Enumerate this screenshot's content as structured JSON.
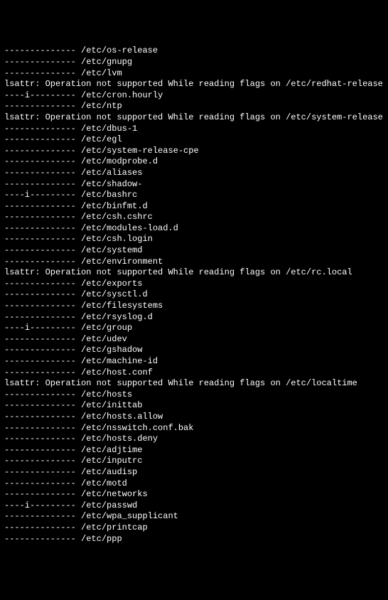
{
  "attr_normal": "--------------",
  "attr_immutable": "----i---------",
  "lines": [
    {
      "type": "entry",
      "attrs": "normal",
      "path": "/etc/os-release"
    },
    {
      "type": "entry",
      "attrs": "normal",
      "path": "/etc/gnupg"
    },
    {
      "type": "entry",
      "attrs": "normal",
      "path": "/etc/lvm"
    },
    {
      "type": "error",
      "text": "lsattr: Operation not supported While reading flags on /etc/redhat-release"
    },
    {
      "type": "entry",
      "attrs": "immutable",
      "path": "/etc/cron.hourly"
    },
    {
      "type": "entry",
      "attrs": "normal",
      "path": "/etc/ntp"
    },
    {
      "type": "error",
      "text": "lsattr: Operation not supported While reading flags on /etc/system-release"
    },
    {
      "type": "entry",
      "attrs": "normal",
      "path": "/etc/dbus-1"
    },
    {
      "type": "entry",
      "attrs": "normal",
      "path": "/etc/egl"
    },
    {
      "type": "entry",
      "attrs": "normal",
      "path": "/etc/system-release-cpe"
    },
    {
      "type": "entry",
      "attrs": "normal",
      "path": "/etc/modprobe.d"
    },
    {
      "type": "entry",
      "attrs": "normal",
      "path": "/etc/aliases"
    },
    {
      "type": "entry",
      "attrs": "normal",
      "path": "/etc/shadow-"
    },
    {
      "type": "entry",
      "attrs": "immutable",
      "path": "/etc/bashrc"
    },
    {
      "type": "entry",
      "attrs": "normal",
      "path": "/etc/binfmt.d"
    },
    {
      "type": "entry",
      "attrs": "normal",
      "path": "/etc/csh.cshrc"
    },
    {
      "type": "entry",
      "attrs": "normal",
      "path": "/etc/modules-load.d"
    },
    {
      "type": "entry",
      "attrs": "normal",
      "path": "/etc/csh.login"
    },
    {
      "type": "entry",
      "attrs": "normal",
      "path": "/etc/systemd"
    },
    {
      "type": "entry",
      "attrs": "normal",
      "path": "/etc/environment"
    },
    {
      "type": "error",
      "text": "lsattr: Operation not supported While reading flags on /etc/rc.local"
    },
    {
      "type": "entry",
      "attrs": "normal",
      "path": "/etc/exports"
    },
    {
      "type": "entry",
      "attrs": "normal",
      "path": "/etc/sysctl.d"
    },
    {
      "type": "entry",
      "attrs": "normal",
      "path": "/etc/filesystems"
    },
    {
      "type": "entry",
      "attrs": "normal",
      "path": "/etc/rsyslog.d"
    },
    {
      "type": "entry",
      "attrs": "immutable",
      "path": "/etc/group"
    },
    {
      "type": "entry",
      "attrs": "normal",
      "path": "/etc/udev"
    },
    {
      "type": "entry",
      "attrs": "normal",
      "path": "/etc/gshadow"
    },
    {
      "type": "entry",
      "attrs": "normal",
      "path": "/etc/machine-id"
    },
    {
      "type": "entry",
      "attrs": "normal",
      "path": "/etc/host.conf"
    },
    {
      "type": "error",
      "text": "lsattr: Operation not supported While reading flags on /etc/localtime"
    },
    {
      "type": "entry",
      "attrs": "normal",
      "path": "/etc/hosts"
    },
    {
      "type": "entry",
      "attrs": "normal",
      "path": "/etc/inittab"
    },
    {
      "type": "entry",
      "attrs": "normal",
      "path": "/etc/hosts.allow"
    },
    {
      "type": "entry",
      "attrs": "normal",
      "path": "/etc/nsswitch.conf.bak"
    },
    {
      "type": "entry",
      "attrs": "normal",
      "path": "/etc/hosts.deny"
    },
    {
      "type": "entry",
      "attrs": "normal",
      "path": "/etc/adjtime"
    },
    {
      "type": "entry",
      "attrs": "normal",
      "path": "/etc/inputrc"
    },
    {
      "type": "entry",
      "attrs": "normal",
      "path": "/etc/audisp"
    },
    {
      "type": "entry",
      "attrs": "normal",
      "path": "/etc/motd"
    },
    {
      "type": "entry",
      "attrs": "normal",
      "path": "/etc/networks"
    },
    {
      "type": "entry",
      "attrs": "immutable",
      "path": "/etc/passwd"
    },
    {
      "type": "entry",
      "attrs": "normal",
      "path": "/etc/wpa_supplicant"
    },
    {
      "type": "entry",
      "attrs": "normal",
      "path": "/etc/printcap"
    },
    {
      "type": "entry",
      "attrs": "normal",
      "path": "/etc/ppp"
    }
  ]
}
